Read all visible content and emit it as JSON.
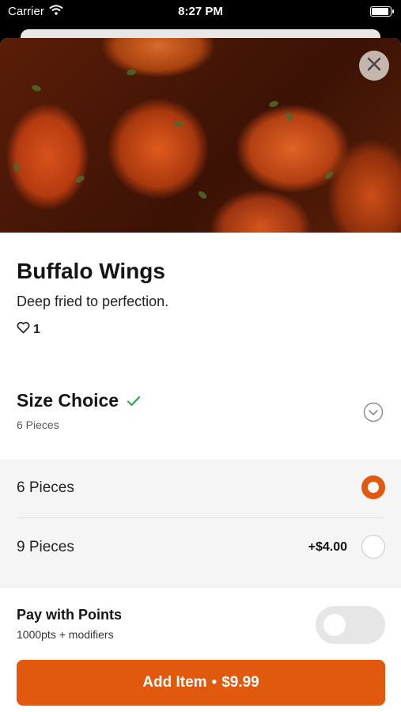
{
  "status_bar": {
    "carrier": "Carrier",
    "time": "8:27 PM"
  },
  "item": {
    "title": "Buffalo Wings",
    "description": "Deep fried to perfection.",
    "likes": "1"
  },
  "modifier_group": {
    "title": "Size Choice",
    "selected_summary": "6 Pieces",
    "options": [
      {
        "label": "6 Pieces",
        "price": "",
        "selected": true
      },
      {
        "label": "9 Pieces",
        "price": "+$4.00",
        "selected": false
      }
    ]
  },
  "points": {
    "title": "Pay with Points",
    "subtitle": "1000pts + modifiers",
    "enabled": false
  },
  "add_button": {
    "label": "Add Item",
    "separator": "•",
    "price": "$9.99"
  },
  "colors": {
    "accent": "#e0590c",
    "check": "#2fa84f"
  },
  "icons": [
    "wifi-icon",
    "battery-icon",
    "close-icon",
    "heart-icon",
    "check-icon",
    "chevron-down-icon"
  ]
}
